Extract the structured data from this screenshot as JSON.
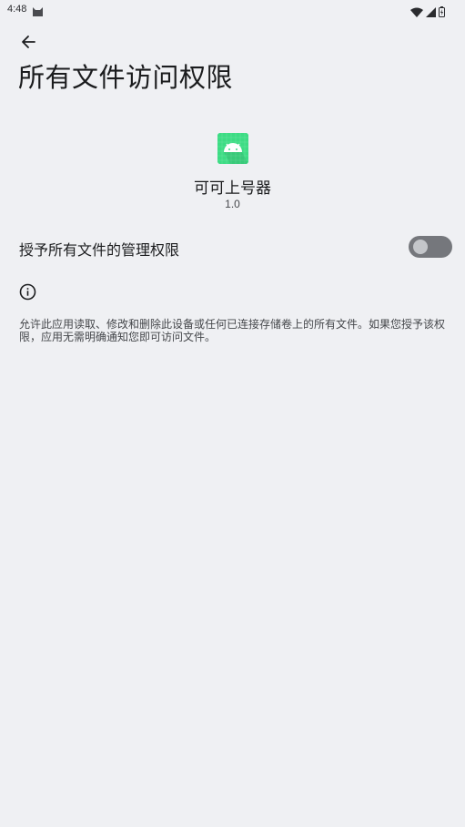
{
  "status_bar": {
    "time": "4:48",
    "icons": [
      "cat-icon",
      "wifi-icon",
      "cellular-signal-icon",
      "battery-charging-icon"
    ]
  },
  "header": {
    "back_icon": "arrow-back-icon",
    "title": "所有文件访问权限"
  },
  "app": {
    "icon": "android-app-icon",
    "name": "可可上号器",
    "version": "1.0"
  },
  "permission": {
    "label": "授予所有文件的管理权限",
    "enabled": false
  },
  "info": {
    "icon": "info-icon",
    "description": "允许此应用读取、修改和删除此设备或任何已连接存储卷上的所有文件。如果您授予该权限，应用无需明确通知您即可访问文件。"
  },
  "colors": {
    "background": "#eff0f3",
    "icon_green": "#3ddc84",
    "toggle_track": "#75777c",
    "toggle_knob": "#c4c6ca"
  }
}
